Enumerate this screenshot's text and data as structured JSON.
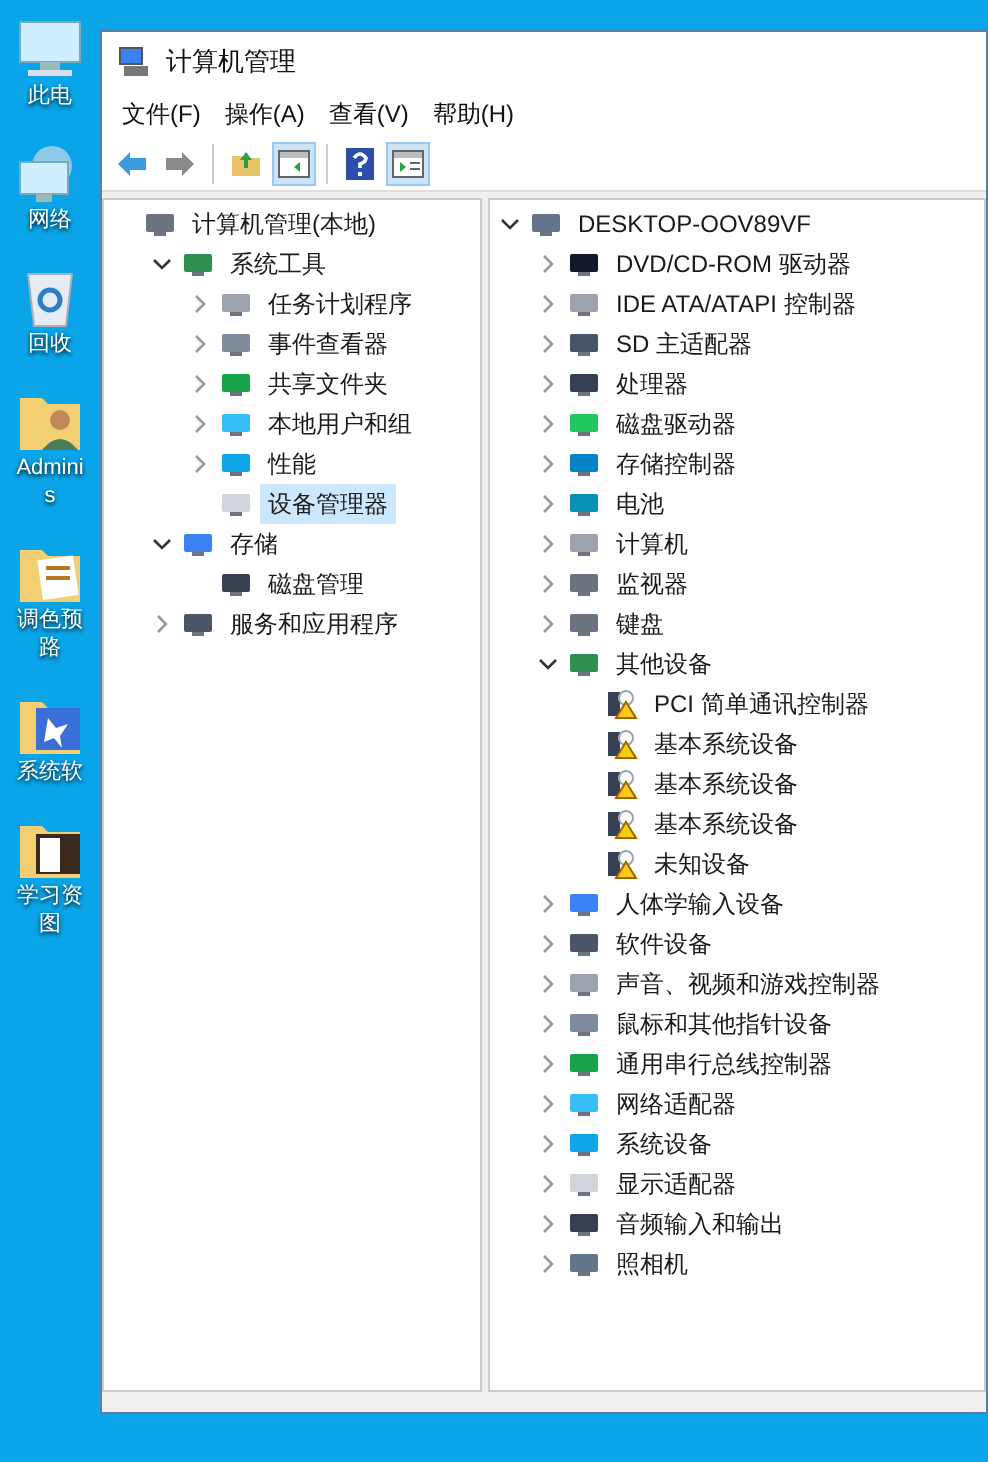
{
  "desktop": {
    "icons": [
      {
        "label": "此电",
        "kind": "pc"
      },
      {
        "label": "网络",
        "kind": "network"
      },
      {
        "label": "回收",
        "kind": "bin"
      },
      {
        "label": "Adminis",
        "kind": "user"
      },
      {
        "label": "调色预路",
        "kind": "folder"
      },
      {
        "label": "系统软",
        "kind": "folder2"
      },
      {
        "label": "学习资图",
        "kind": "folder3"
      }
    ]
  },
  "window": {
    "title": "计算机管理"
  },
  "menu": [
    "文件(F)",
    "操作(A)",
    "查看(V)",
    "帮助(H)"
  ],
  "toolbar": [
    {
      "kind": "back",
      "pressed": false
    },
    {
      "kind": "forward",
      "pressed": false
    },
    {
      "kind": "sep"
    },
    {
      "kind": "up",
      "pressed": false
    },
    {
      "kind": "tree",
      "pressed": true
    },
    {
      "kind": "sep"
    },
    {
      "kind": "help",
      "pressed": false
    },
    {
      "kind": "pane",
      "pressed": true
    }
  ],
  "left_tree": [
    {
      "label": "计算机管理(本地)",
      "selected": false,
      "children": [
        {
          "label": "系统工具",
          "expanded": true,
          "selected": false,
          "children": [
            {
              "label": "任务计划程序",
              "expanded": false,
              "selected": false
            },
            {
              "label": "事件查看器",
              "expanded": false,
              "selected": false
            },
            {
              "label": "共享文件夹",
              "expanded": false,
              "selected": false
            },
            {
              "label": "本地用户和组",
              "expanded": false,
              "selected": false
            },
            {
              "label": "性能",
              "expanded": false,
              "selected": false
            },
            {
              "label": "设备管理器",
              "selected": true
            }
          ]
        },
        {
          "label": "存储",
          "expanded": true,
          "selected": false,
          "children": [
            {
              "label": "磁盘管理",
              "selected": false
            }
          ]
        },
        {
          "label": "服务和应用程序",
          "expanded": false,
          "selected": false
        }
      ]
    }
  ],
  "device_tree": [
    {
      "label": "DESKTOP-OOV89VF",
      "expanded": true,
      "selected": false,
      "children": [
        {
          "label": "DVD/CD-ROM 驱动器",
          "expanded": false,
          "selected": false
        },
        {
          "label": "IDE ATA/ATAPI 控制器",
          "expanded": false,
          "selected": false
        },
        {
          "label": "SD 主适配器",
          "expanded": false,
          "selected": false
        },
        {
          "label": "处理器",
          "expanded": false,
          "selected": false
        },
        {
          "label": "磁盘驱动器",
          "expanded": false,
          "selected": false
        },
        {
          "label": "存储控制器",
          "expanded": false,
          "selected": false
        },
        {
          "label": "电池",
          "expanded": false,
          "selected": false
        },
        {
          "label": "计算机",
          "expanded": false,
          "selected": false
        },
        {
          "label": "监视器",
          "expanded": false,
          "selected": false
        },
        {
          "label": "键盘",
          "expanded": false,
          "selected": false
        },
        {
          "label": "其他设备",
          "expanded": true,
          "selected": false,
          "children": [
            {
              "label": "PCI 简单通讯控制器",
              "selected": false,
              "warning": true
            },
            {
              "label": "基本系统设备",
              "selected": false,
              "warning": true
            },
            {
              "label": "基本系统设备",
              "selected": false,
              "warning": true
            },
            {
              "label": "基本系统设备",
              "selected": false,
              "warning": true
            },
            {
              "label": "未知设备",
              "selected": false,
              "warning": true
            }
          ]
        },
        {
          "label": "人体学输入设备",
          "expanded": false,
          "selected": false
        },
        {
          "label": "软件设备",
          "expanded": false,
          "selected": false
        },
        {
          "label": "声音、视频和游戏控制器",
          "expanded": false,
          "selected": false
        },
        {
          "label": "鼠标和其他指针设备",
          "expanded": false,
          "selected": false
        },
        {
          "label": "通用串行总线控制器",
          "expanded": false,
          "selected": false
        },
        {
          "label": "网络适配器",
          "expanded": false,
          "selected": false
        },
        {
          "label": "系统设备",
          "expanded": false,
          "selected": false
        },
        {
          "label": "显示适配器",
          "expanded": false,
          "selected": false
        },
        {
          "label": "音频输入和输出",
          "expanded": false,
          "selected": false
        },
        {
          "label": "照相机",
          "expanded": false,
          "selected": false
        }
      ]
    }
  ]
}
